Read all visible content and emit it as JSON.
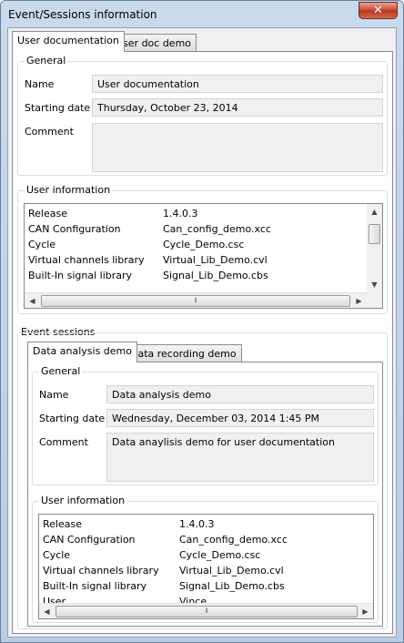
{
  "window": {
    "title": "Event/Sessions information",
    "close_glyph": "✕"
  },
  "tabs": [
    "User documentation",
    "User doc demo"
  ],
  "doc": {
    "general_label": "General",
    "name_label": "Name",
    "name_value": "User documentation",
    "date_label": "Starting date",
    "date_value": "Thursday, October 23, 2014",
    "comment_label": "Comment",
    "comment_value": "",
    "user_info_label": "User information",
    "user_info": [
      {
        "key": "Release",
        "value": "1.4.0.3"
      },
      {
        "key": "CAN Configuration",
        "value": "Can_config_demo.xcc"
      },
      {
        "key": "Cycle",
        "value": "Cycle_Demo.csc"
      },
      {
        "key": "Virtual channels library",
        "value": "Virtual_Lib_Demo.cvl"
      },
      {
        "key": "Built-In signal library",
        "value": "Signal_Lib_Demo.cbs"
      }
    ]
  },
  "event_sessions_label": "Event sessions",
  "session_tabs": [
    "Data analysis demo",
    "Data recording demo"
  ],
  "session": {
    "general_label": "General",
    "name_label": "Name",
    "name_value": "Data analysis demo",
    "date_label": "Starting date",
    "date_value": "Wednesday, December 03, 2014 1:45 PM",
    "comment_label": "Comment",
    "comment_value": "Data anaylisis demo for user documentation",
    "user_info_label": "User information",
    "user_info": [
      {
        "key": "Release",
        "value": "1.4.0.3"
      },
      {
        "key": "CAN Configuration",
        "value": "Can_config_demo.xcc"
      },
      {
        "key": "Cycle",
        "value": "Cycle_Demo.csc"
      },
      {
        "key": "Virtual channels library",
        "value": "Virtual_Lib_Demo.cvl"
      },
      {
        "key": "Built-In signal library",
        "value": "Signal_Lib_Demo.cbs"
      },
      {
        "key": "User",
        "value": "Vince"
      }
    ]
  },
  "icons": {
    "left": "◀",
    "right": "▶",
    "up": "▲",
    "down": "▼",
    "grip": "⦀"
  }
}
